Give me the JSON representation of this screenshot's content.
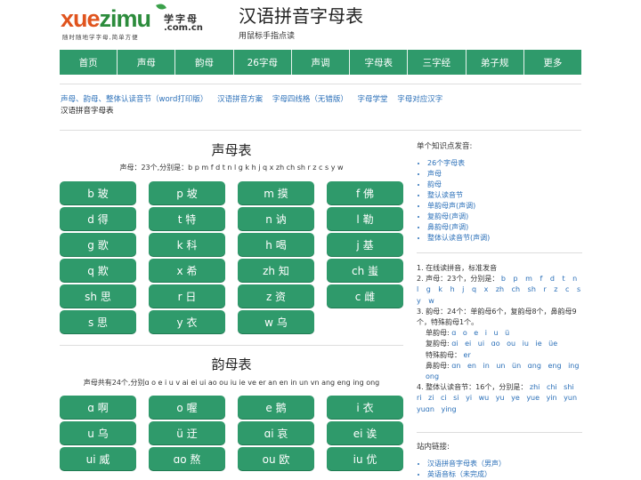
{
  "logo": {
    "word_a": "xue",
    "word_b": "zimu",
    "cn": "学字母",
    "domain": ".com.cn",
    "slogan": "随时随地学字母,简单方便"
  },
  "page": {
    "title": "汉语拼音字母表",
    "subtitle": "用鼠标手指点读"
  },
  "nav": [
    "首页",
    "声母",
    "韵母",
    "26字母",
    "声调",
    "字母表",
    "三字经",
    "弟子规",
    "更多"
  ],
  "links": [
    "声母、韵母、整体认读音节（word打印版）",
    "汉语拼音方案",
    "字母四线格（无错版）",
    "字母学堂",
    "字母对应汉字"
  ],
  "breadcrumb": "汉语拼音字母表",
  "shengmu": {
    "title": "声母表",
    "desc": "声母：23个,分别是：b p m f d t n l g k h j q x zh ch sh r z c s y w",
    "items": [
      "b 玻",
      "p 坡",
      "m 摸",
      "f 佛",
      "d 得",
      "t 特",
      "n 讷",
      "l 勒",
      "g 歌",
      "k 科",
      "h 喝",
      "j 基",
      "q 欺",
      "x 希",
      "zh 知",
      "ch 蚩",
      "sh 思",
      "r 日",
      "z 资",
      "c 雌",
      "s 思",
      "y 衣",
      "w 乌"
    ]
  },
  "yunmu": {
    "title": "韵母表",
    "desc": "声母共有24个,分别ɑ o e i u v ai ei ui ao ou iu ie ve er an en in un vn ang eng ing ong",
    "items": [
      "ɑ 啊",
      "o 喔",
      "e 鹅",
      "i 衣",
      "u 乌",
      "ü 迂",
      "ɑi 哀",
      "ei 诶",
      "ui 威",
      "ɑo 熬",
      "ou 欧",
      "iu 优"
    ]
  },
  "sidebar": {
    "heading1": "单个知识点发音:",
    "list1": [
      "26个字母表",
      "声母",
      "韵母",
      "整认读音节",
      "单韵母声(声调)",
      "复韵母(声调)",
      "鼻韵母(声调)",
      "整体认读音节(声调)"
    ],
    "notes": {
      "n1": "1. 在线读拼音，标准发音",
      "n2_label": "2. 声母：23个，分别是：",
      "n2_values": "b p m f d t n l g k h j q x zh ch sh r z c s y w",
      "n3": "3. 韵母：24个：单韵母6个，复韵母8个，鼻韵母9个，特殊韵母1个。",
      "single_label": "单韵母:",
      "single_values": "ɑ o e i u ü",
      "compound_label": "复韵母:",
      "compound_values": "ɑi ei ui ɑo ou iu ie üe",
      "special_label": "特殊韵母：",
      "special_values": "er",
      "nasal_label": "鼻韵母:",
      "nasal_values": "ɑn en in un ün ɑng eng ing ong",
      "n4_label": "4. 整体认读音节：16个，分别是：",
      "n4_values": "zhi chi shi ri zi ci si yi wu yu ye yue yin yun yuɑn ying"
    },
    "heading2": "站内链接:",
    "list2": [
      "汉语拼音字母表（男声）",
      "英语音标（未完成）"
    ]
  }
}
